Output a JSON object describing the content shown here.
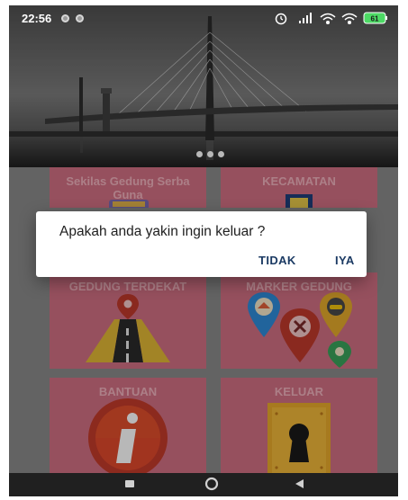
{
  "status_bar": {
    "time": "22:56",
    "battery": "61"
  },
  "banner": {
    "pager_dots": 3
  },
  "tiles": [
    {
      "title": "Sekilas Gedung Serba\nGuna",
      "icon": "building-icon"
    },
    {
      "title": "KECAMATAN",
      "icon": "map-icon"
    },
    {
      "title": "GEDUNG TERDEKAT",
      "icon": "road-pin-icon"
    },
    {
      "title": "MARKER GEDUNG",
      "icon": "markers-icon"
    },
    {
      "title": "BANTUAN",
      "icon": "info-icon"
    },
    {
      "title": "KELUAR",
      "icon": "keyhole-door-icon"
    }
  ],
  "dialog": {
    "message": "Apakah anda yakin ingin keluar ?",
    "negative_label": "TIDAK",
    "positive_label": "IYA"
  },
  "nav_bar": {
    "icons": [
      "recents-icon",
      "home-icon",
      "back-icon"
    ]
  },
  "colors": {
    "tile": "#d07083",
    "tile_title": "#efb0bc",
    "dialog_button": "#1b3a63"
  }
}
